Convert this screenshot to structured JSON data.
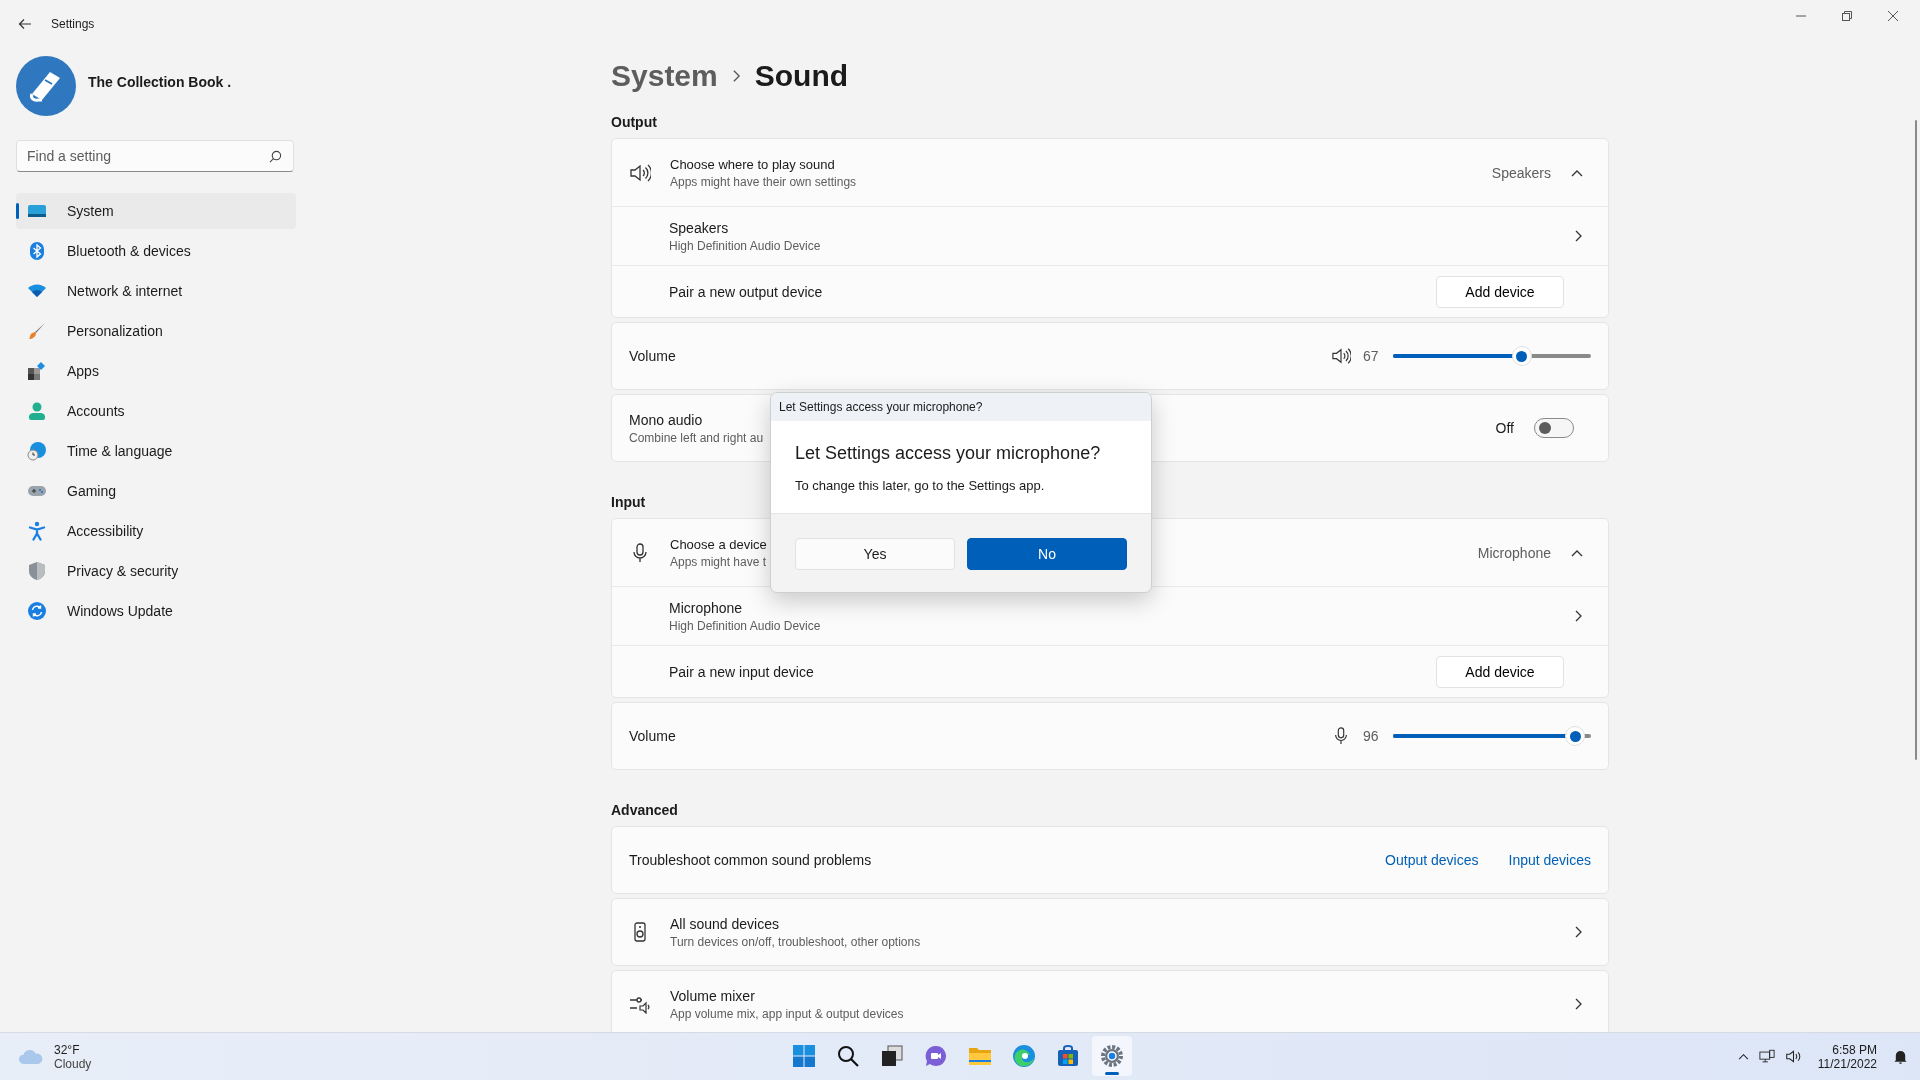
{
  "window": {
    "title": "Settings"
  },
  "account": {
    "name": "The Collection Book ."
  },
  "search": {
    "placeholder": "Find a setting"
  },
  "nav": [
    {
      "label": "System",
      "selected": true
    },
    {
      "label": "Bluetooth & devices",
      "selected": false
    },
    {
      "label": "Network & internet",
      "selected": false
    },
    {
      "label": "Personalization",
      "selected": false
    },
    {
      "label": "Apps",
      "selected": false
    },
    {
      "label": "Accounts",
      "selected": false
    },
    {
      "label": "Time & language",
      "selected": false
    },
    {
      "label": "Gaming",
      "selected": false
    },
    {
      "label": "Accessibility",
      "selected": false
    },
    {
      "label": "Privacy & security",
      "selected": false
    },
    {
      "label": "Windows Update",
      "selected": false
    }
  ],
  "breadcrumb": [
    "System",
    "Sound"
  ],
  "sections": [
    {
      "title": "Output",
      "cards": [
        {
          "kind": "expander",
          "title": "Choose where to play sound",
          "subtitle": "Apps might have their own settings",
          "value": "Speakers",
          "expanded": true,
          "rows": [
            {
              "kind": "device",
              "title": "Speakers",
              "subtitle": "High Definition Audio Device"
            },
            {
              "kind": "pair",
              "title": "Pair a new output device",
              "button": "Add device"
            }
          ]
        },
        {
          "kind": "slider",
          "title": "Volume",
          "reading": "67",
          "level": 0.65
        },
        {
          "kind": "toggle",
          "title": "Mono audio",
          "subtitle": "Combine left and right au",
          "state_text": "Off",
          "on": false
        }
      ]
    },
    {
      "title": "Input",
      "cards": [
        {
          "kind": "expander",
          "title": "Choose a device",
          "subtitle": "Apps might have t",
          "value": "Microphone",
          "expanded": true,
          "rows": [
            {
              "kind": "device",
              "title": "Microphone",
              "subtitle": "High Definition Audio Device"
            },
            {
              "kind": "pair",
              "title": "Pair a new input device",
              "button": "Add device"
            }
          ]
        },
        {
          "kind": "slider",
          "title": "Volume",
          "reading": "96",
          "level": 0.92
        }
      ]
    },
    {
      "title": "Advanced",
      "cards": [
        {
          "kind": "links",
          "title": "Troubleshoot common sound problems",
          "links": [
            "Output devices",
            "Input devices"
          ]
        },
        {
          "kind": "nav",
          "title": "All sound devices",
          "subtitle": "Turn devices on/off, troubleshoot, other options"
        },
        {
          "kind": "nav",
          "title": "Volume mixer",
          "subtitle": "App volume mix, app input & output devices"
        }
      ]
    }
  ],
  "dialog": {
    "caption": "Let Settings access your microphone?",
    "title": "Let Settings access your microphone?",
    "message": "To change this later, go to the Settings app.",
    "buttons": [
      {
        "label": "Yes",
        "primary": false
      },
      {
        "label": "No",
        "primary": true
      }
    ]
  },
  "taskbar": {
    "weather": {
      "temp": "32°F",
      "condition": "Cloudy"
    },
    "apps": [
      {
        "selected": false
      },
      {
        "selected": false
      },
      {
        "selected": false
      },
      {
        "selected": false
      },
      {
        "selected": false
      },
      {
        "selected": false
      },
      {
        "selected": false
      },
      {
        "selected": true
      }
    ],
    "time": "6:58 PM",
    "date": "11/21/2022"
  }
}
